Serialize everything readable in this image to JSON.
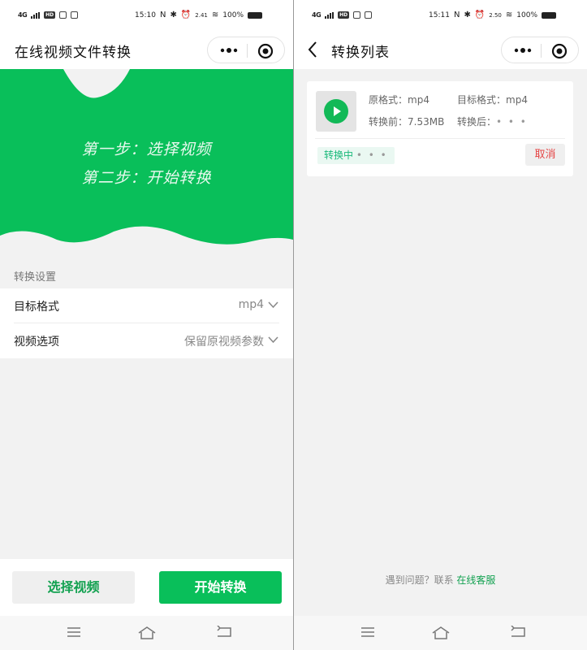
{
  "left_screen": {
    "status_bar": {
      "network": "4G",
      "hd": "HD",
      "time": "15:10",
      "speed": "2.41",
      "battery": "100%"
    },
    "nav": {
      "title": "在线视频文件转换"
    },
    "hero": {
      "step1": "第一步：选择视频",
      "step2": "第二步：开始转换"
    },
    "settings": {
      "section_label": "转换设置",
      "rows": [
        {
          "label": "目标格式",
          "value": "mp4"
        },
        {
          "label": "视频选项",
          "value": "保留原视频参数"
        }
      ]
    },
    "buttons": {
      "choose_label": "选择视频",
      "start_label": "开始转换"
    }
  },
  "right_screen": {
    "status_bar": {
      "network": "4G",
      "hd": "HD",
      "time": "15:11",
      "speed": "2.50",
      "battery": "100%"
    },
    "nav": {
      "title": "转换列表"
    },
    "item": {
      "source_format_label": "原格式：",
      "source_format": "mp4",
      "target_format_label": "目标格式：",
      "target_format": "mp4",
      "before_label": "转换前：",
      "before_size": "7.53MB",
      "after_label": "转换后：",
      "after_value": "• • •",
      "status": "转换中",
      "status_dots": "• • •",
      "cancel_label": "取消"
    },
    "help": {
      "text": "遇到问题？联系 ",
      "link": "在线客服"
    }
  },
  "colors": {
    "brand_green": "#09bf5a",
    "cancel_red": "#e54545",
    "status_teal": "#19b97a"
  },
  "icons": [
    "back-arrow-icon",
    "more-dots-icon",
    "target-icon",
    "chevron-down-icon",
    "play-icon",
    "menu-icon",
    "home-icon",
    "back-icon"
  ]
}
